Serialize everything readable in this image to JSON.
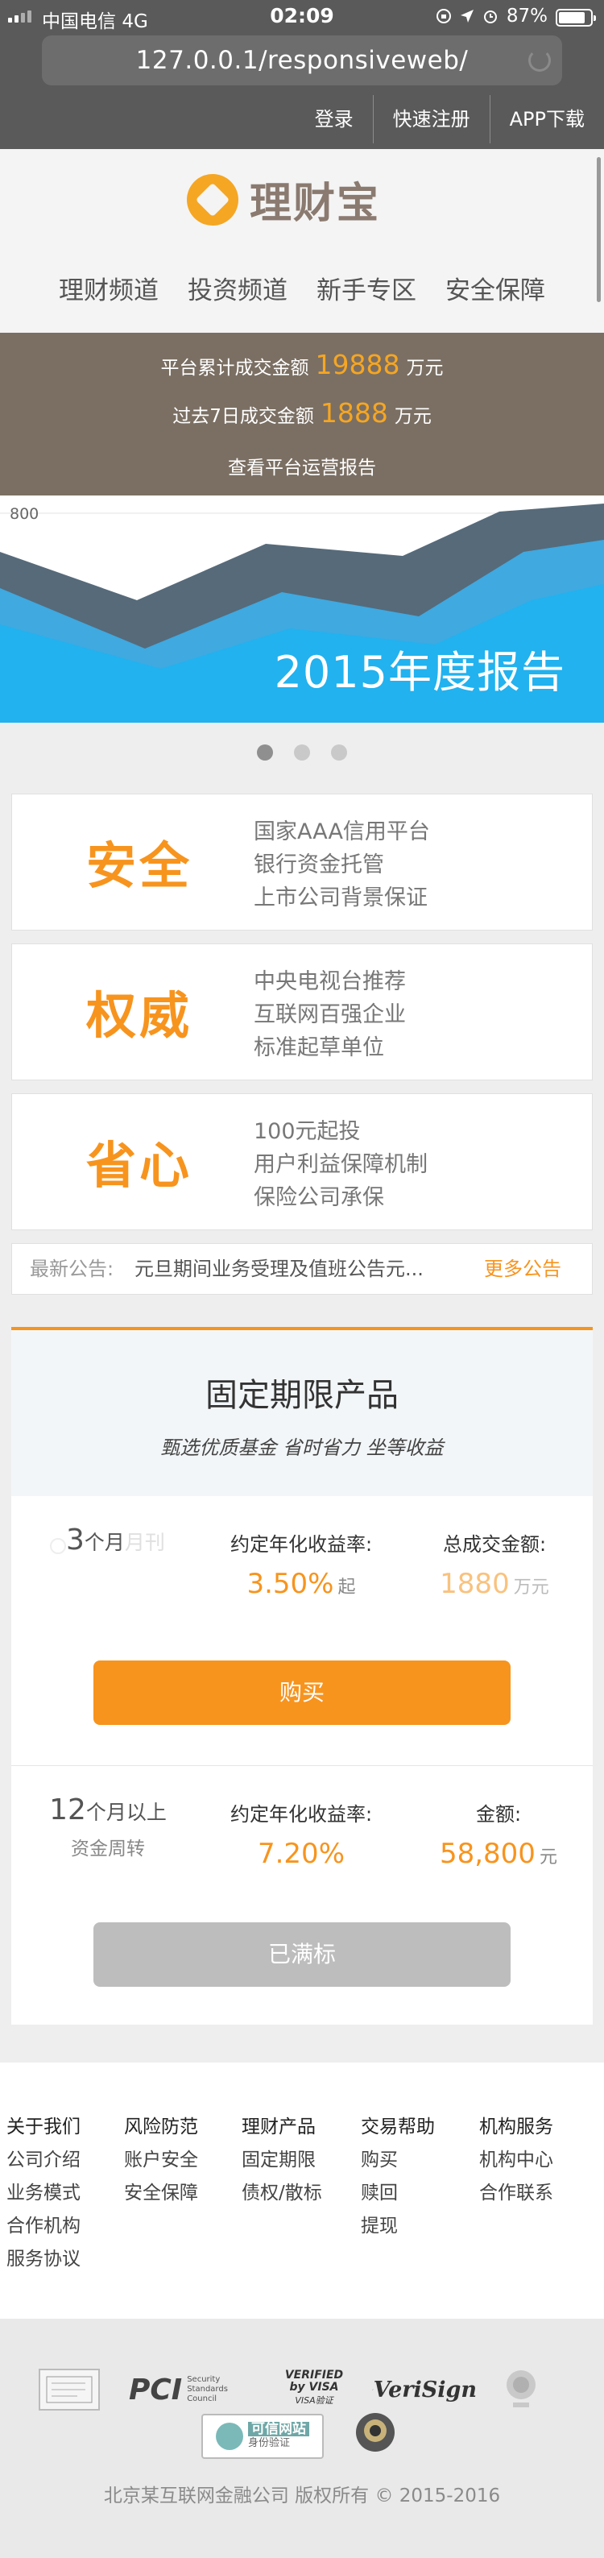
{
  "status_bar": {
    "carrier": "中国电信",
    "network": "4G",
    "time": "02:09",
    "battery": "87%"
  },
  "browser": {
    "url": "127.0.0.1/responsiveweb/"
  },
  "top_nav": {
    "login": "登录",
    "register": "快速注册",
    "app_download": "APP下载"
  },
  "brand": {
    "name": "理财宝",
    "accent": "#f7941e"
  },
  "main_nav": [
    "理财频道",
    "投资频道",
    "新手专区",
    "安全保障"
  ],
  "stats": {
    "total_prefix": "平台累计成交金额",
    "total_value": "19888",
    "total_unit": "万元",
    "week_prefix": "过去7日成交金额",
    "week_value": "1888",
    "week_unit": "万元",
    "report_link": "查看平台运营报告"
  },
  "banner": {
    "axis_label": "800",
    "title": "2015年度报告",
    "slides": 3,
    "active_slide": 0
  },
  "features": [
    {
      "title": "安全",
      "items": [
        "国家AAA信用平台",
        "银行资金托管",
        "上市公司背景保证"
      ]
    },
    {
      "title": "权威",
      "items": [
        "中央电视台推荐",
        "互联网百强企业",
        "标准起草单位"
      ]
    },
    {
      "title": "省心",
      "items": [
        "100元起投",
        "用户利益保障机制",
        "保险公司承保"
      ]
    }
  ],
  "notice": {
    "label": "最新公告:",
    "text": "元旦期间业务受理及值班公告元...",
    "more": "更多公告"
  },
  "products": {
    "title": "固定期限产品",
    "subtitle": "甄选优质基金  省时省力  坐等收益",
    "items": [
      {
        "term_num": "3",
        "term_unit": "个月",
        "term_ghost": "月刊",
        "rate_label": "约定年化收益率:",
        "rate": "3.50%",
        "rate_suffix": "起",
        "amount_label": "总成交金额:",
        "amount": "1880",
        "amount_unit": "万元",
        "button": "购买"
      },
      {
        "term_num": "12",
        "term_unit": "个月以上",
        "term_sub": "资金周转",
        "rate_label": "约定年化收益率:",
        "rate": "7.20%",
        "amount_label": "金额:",
        "amount": "58,800",
        "amount_unit": "元",
        "button": "已满标"
      }
    ]
  },
  "footer_links": [
    {
      "heading": "关于我们",
      "items": [
        "公司介绍",
        "业务模式",
        "合作机构",
        "服务协议"
      ]
    },
    {
      "heading": "风险防范",
      "items": [
        "账户安全",
        "安全保障"
      ]
    },
    {
      "heading": "理财产品",
      "items": [
        "固定期限",
        "债权/散标"
      ]
    },
    {
      "heading": "交易帮助",
      "items": [
        "购买",
        "赎回",
        "提现"
      ]
    },
    {
      "heading": "机构服务",
      "items": [
        "机构中心",
        "合作联系"
      ]
    }
  ],
  "trust_badges": {
    "pci": "PCI",
    "pci_sub": "Security Standards Council",
    "visa": "VERIFIED by VISA",
    "visa_sub": "VISA验证",
    "verisign": "VeriSign",
    "credible": "可信网站",
    "credible_sub": "身份验证"
  },
  "copyright": "北京某互联网金融公司 版权所有 © 2015-2016"
}
